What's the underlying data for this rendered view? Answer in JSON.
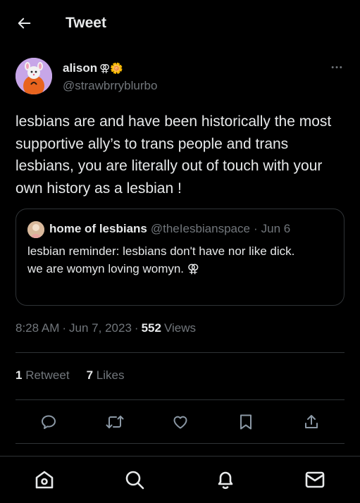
{
  "header": {
    "title": "Tweet",
    "back_icon": "arrow-left-icon"
  },
  "author": {
    "display_name": "alison",
    "name_emojis": "⚢🌼",
    "handle": "@strawbrryblurbo",
    "more_icon": "more-horizontal-icon",
    "more_label": "•••"
  },
  "tweet": {
    "text": "lesbians are and have been historically the most supportive ally’s to trans people and trans lesbians, you are literally out of touch with your own history as a lesbian !"
  },
  "quote": {
    "name": "home of lesbians",
    "handle": "@theIesbianspace",
    "separator": "·",
    "date": "Jun 6",
    "text": "lesbian reminder: lesbians don't have nor like dick.\nwe are womyn loving womyn. ⚢"
  },
  "meta": {
    "time": "8:28 AM",
    "sep1": "·",
    "date": "Jun 7, 2023",
    "sep2": "·",
    "views_count": "552",
    "views_label": "Views"
  },
  "stats": {
    "retweets_count": "1",
    "retweets_label": "Retweet",
    "likes_count": "7",
    "likes_label": "Likes"
  },
  "actions": [
    "reply-icon",
    "retweet-icon",
    "like-icon",
    "bookmark-icon",
    "share-icon"
  ],
  "bottom_nav": [
    "home-icon",
    "search-icon",
    "notifications-icon",
    "messages-icon"
  ],
  "colors": {
    "background": "#000000",
    "text": "#e7e9ea",
    "secondary": "#71767b",
    "divider": "#2f3336"
  }
}
